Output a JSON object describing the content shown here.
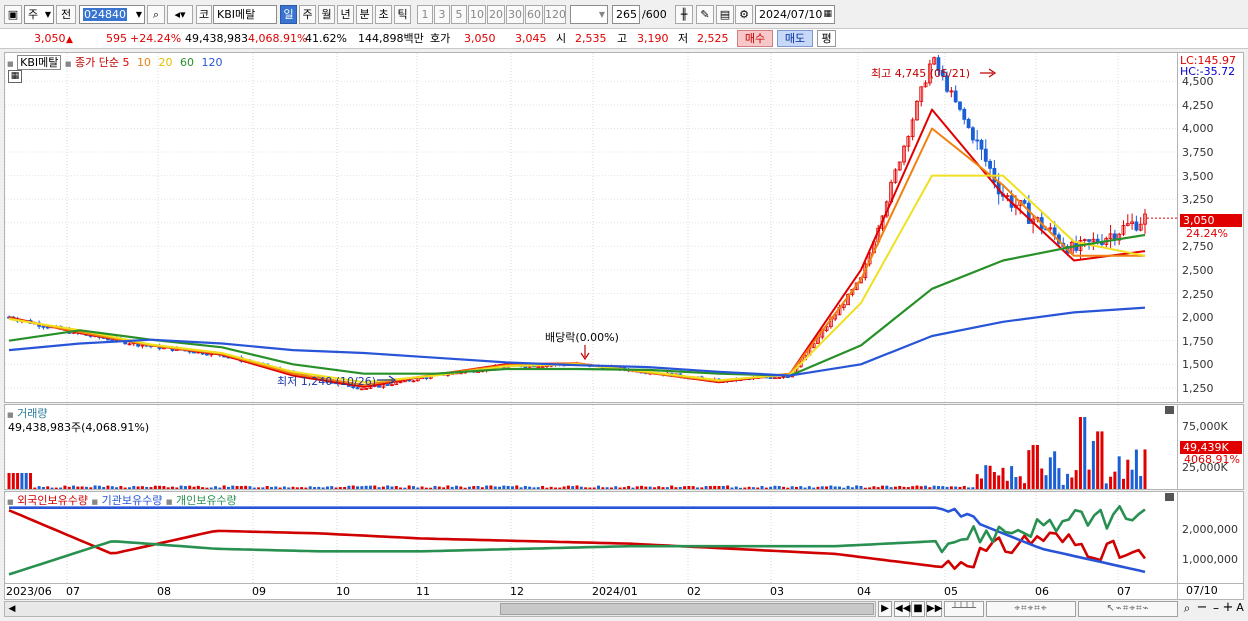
{
  "toolbar": {
    "market_prefix": "주",
    "prev_label": "전",
    "code": "024840",
    "market_kind": "코",
    "stock_name": "KBI메탈",
    "periods": [
      "일",
      "주",
      "월",
      "년",
      "분",
      "초",
      "틱"
    ],
    "selected_period": "일",
    "intervals": [
      "1",
      "3",
      "5",
      "10",
      "20",
      "30",
      "60",
      "120"
    ],
    "count": "265",
    "count_max": "/600",
    "date": "2024/07/10"
  },
  "quote": {
    "price": "3,050",
    "arrow": "▲",
    "change": "595",
    "change_pct": "+24.24%",
    "volume": "49,438,983",
    "volume_pct": "4,068.91%",
    "turnover_pct": "41.62%",
    "amount": "144,898백만",
    "ask_label": "호가",
    "ask": "3,050",
    "bid": "3,045",
    "open_label": "시",
    "open": "2,535",
    "high_label": "고",
    "high": "3,190",
    "low_label": "저",
    "low": "2,525",
    "buy_label": "매수",
    "sell_label": "매도",
    "avg_label": "평"
  },
  "colors": {
    "up": "#e00000",
    "down": "#1a5fd6",
    "ma5": "#e00000",
    "ma10": "#f08010",
    "ma20": "#f0e020",
    "ma60": "#289028",
    "ma120": "#2855d8"
  },
  "price_panel": {
    "name": "KBI메탈",
    "series_label": "종가 단순",
    "ma_periods": [
      "5",
      "10",
      "20",
      "60",
      "120"
    ],
    "y_ticks": [
      "4,500",
      "4,250",
      "4,000",
      "3,750",
      "3,500",
      "3,250",
      "3,000",
      "2,750",
      "2,500",
      "2,250",
      "2,000",
      "1,750",
      "1,500",
      "1,250"
    ],
    "lc": "LC:145.97",
    "hc": "HC:-35.72",
    "current_tag": "3,050",
    "current_pct": "24.24%",
    "high_annotation": "최고 4,745 (05/21)",
    "low_annotation": "최저 1,240 (10/26)",
    "dividend_annotation": "배당락(0.00%)"
  },
  "volume_panel": {
    "name": "거래량",
    "value": "49,438,983주(4,068.91%)",
    "y_ticks": [
      "75,000K",
      "25,000K"
    ],
    "current_tag": "49,439K",
    "current_pct": "4068.91%"
  },
  "holdings_panel": {
    "legends": [
      "외국인보유수량",
      "기관보유수량",
      "개인보유수량"
    ],
    "y_ticks": [
      "2,000,000",
      "1,000,000"
    ]
  },
  "x_labels": [
    "2023/06",
    "07",
    "08",
    "09",
    "10",
    "11",
    "12",
    "2024/01",
    "02",
    "03",
    "04",
    "05",
    "06",
    "07"
  ],
  "x_axis_end": "07/10",
  "chart_data": {
    "type": "line",
    "title": "",
    "price": {
      "dates": [
        "2023/06",
        "07",
        "08",
        "09",
        "10",
        "10/26",
        "11",
        "12",
        "2024/01",
        "02",
        "03",
        "04",
        "05",
        "05/21",
        "06",
        "07",
        "07/10"
      ],
      "close": [
        2000,
        1820,
        1690,
        1600,
        1400,
        1240,
        1380,
        1480,
        1500,
        1420,
        1320,
        1380,
        2400,
        4745,
        3300,
        2700,
        3050
      ],
      "ylim": [
        1100,
        4800
      ]
    },
    "series": [
      {
        "name": "5",
        "values": [
          2000,
          1830,
          1700,
          1600,
          1380,
          1260,
          1390,
          1500,
          1510,
          1410,
          1310,
          1400,
          2500,
          4200,
          3300,
          2600,
          2700
        ]
      },
      {
        "name": "10",
        "values": [
          1990,
          1840,
          1700,
          1610,
          1400,
          1280,
          1390,
          1490,
          1510,
          1410,
          1320,
          1400,
          2400,
          4000,
          3400,
          2650,
          2650
        ]
      },
      {
        "name": "20",
        "values": [
          1980,
          1860,
          1710,
          1620,
          1420,
          1310,
          1380,
          1480,
          1500,
          1420,
          1330,
          1390,
          2150,
          3500,
          3500,
          2800,
          2650
        ]
      },
      {
        "name": "60",
        "values": [
          1750,
          1860,
          1760,
          1680,
          1500,
          1400,
          1400,
          1450,
          1450,
          1440,
          1400,
          1380,
          1700,
          2300,
          2600,
          2750,
          2870
        ]
      },
      {
        "name": "120",
        "values": [
          1650,
          1720,
          1760,
          1720,
          1650,
          1620,
          1570,
          1520,
          1490,
          1470,
          1420,
          1380,
          1500,
          1800,
          1950,
          2050,
          2100
        ]
      }
    ],
    "volume": {
      "current": "49,439K",
      "ylim": [
        0,
        100000
      ]
    },
    "holdings": {
      "series": [
        {
          "name": "외국인보유수량",
          "values": [
            2600000,
            900000,
            1800000,
            1700000,
            1500000,
            1400000,
            1300000,
            1100000,
            900000,
            400000,
            1600000,
            700000
          ]
        },
        {
          "name": "기관보유수량",
          "values": [
            2700000,
            2700000,
            2700000,
            2700000,
            2700000,
            2700000,
            2700000,
            2700000,
            2700000,
            2700000,
            1100000,
            200000
          ]
        },
        {
          "name": "개인보유수량",
          "values": [
            100000,
            1400000,
            1100000,
            1000000,
            1000000,
            1100000,
            1200000,
            1200000,
            1200000,
            1400000,
            2000000,
            2500000
          ]
        }
      ],
      "ylim": [
        0,
        3000000
      ]
    }
  }
}
